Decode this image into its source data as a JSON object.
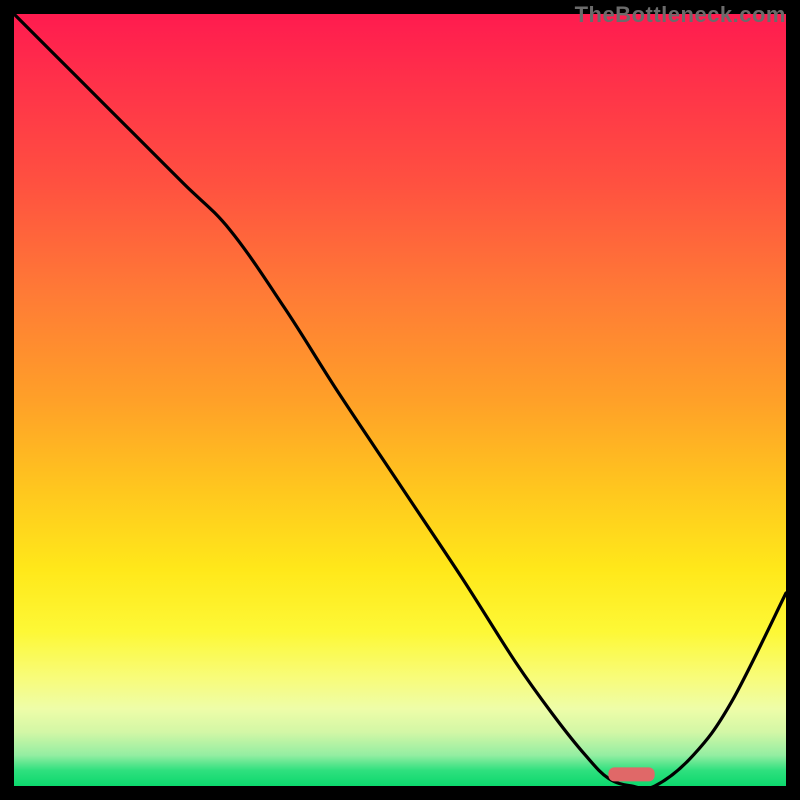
{
  "watermark": "TheBottleneck.com",
  "chart_data": {
    "type": "line",
    "title": "",
    "xlabel": "",
    "ylabel": "",
    "xlim": [
      0,
      100
    ],
    "ylim": [
      0,
      100
    ],
    "series": [
      {
        "name": "bottleneck-curve",
        "x": [
          0,
          8,
          15,
          22,
          28,
          35,
          42,
          50,
          58,
          65,
          70,
          74,
          77,
          80,
          83,
          88,
          93,
          100
        ],
        "y": [
          100,
          92,
          85,
          78,
          72,
          62,
          51,
          39,
          27,
          16,
          9,
          4,
          1,
          0,
          0,
          4,
          11,
          25
        ]
      }
    ],
    "marker": {
      "name": "optimal-range",
      "x_start": 77,
      "x_end": 83,
      "y": 1.5,
      "color": "#e06868"
    },
    "gradient_bands": [
      {
        "pos": 0.0,
        "color": "#ff1b4f"
      },
      {
        "pos": 0.5,
        "color": "#ffa028"
      },
      {
        "pos": 0.8,
        "color": "#fdf836"
      },
      {
        "pos": 1.0,
        "color": "#0cd86d"
      }
    ]
  }
}
